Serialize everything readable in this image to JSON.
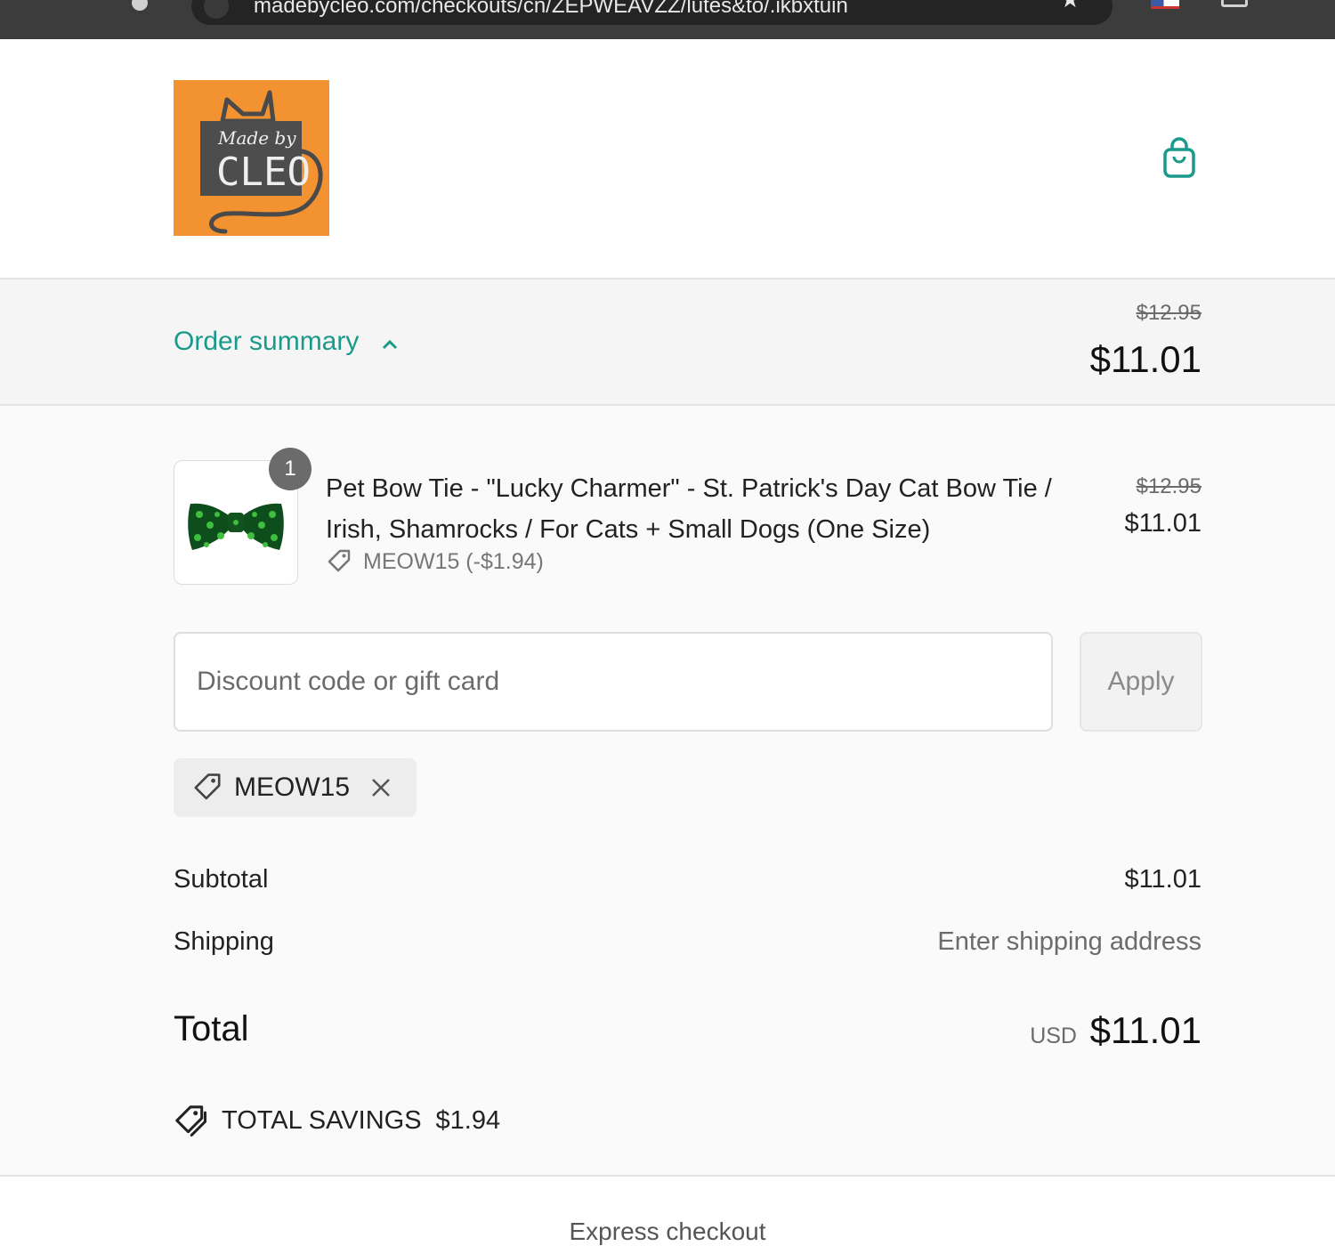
{
  "browser": {
    "url": "madebycleo.com/checkouts/cn/ZEPWEAVZZ/lutes&to/.ikbxtuin"
  },
  "header": {
    "logo_text_top": "Made by",
    "logo_text_main": "CLEO"
  },
  "summary_bar": {
    "toggle_label": "Order summary",
    "compare_total": "$12.95",
    "total": "$11.01"
  },
  "line_item": {
    "quantity": "1",
    "title": "Pet Bow Tie - \"Lucky Charmer\" - St. Patrick's Day Cat Bow Tie / Irish, Shamrocks / For Cats + Small Dogs (One Size)",
    "discount": "MEOW15 (-$1.94)",
    "compare_price": "$12.95",
    "price": "$11.01"
  },
  "discount_form": {
    "placeholder": "Discount code or gift card",
    "apply_label": "Apply"
  },
  "applied_code": {
    "code": "MEOW15"
  },
  "totals": {
    "subtotal_label": "Subtotal",
    "subtotal_value": "$11.01",
    "shipping_label": "Shipping",
    "shipping_value": "Enter shipping address",
    "total_label": "Total",
    "currency": "USD",
    "total_value": "$11.01"
  },
  "savings": {
    "label": "TOTAL SAVINGS",
    "amount": "$1.94"
  },
  "express_checkout": {
    "label": "Express checkout"
  },
  "colors": {
    "accent": "#1a9a8a",
    "logo_orange": "#f39230"
  }
}
